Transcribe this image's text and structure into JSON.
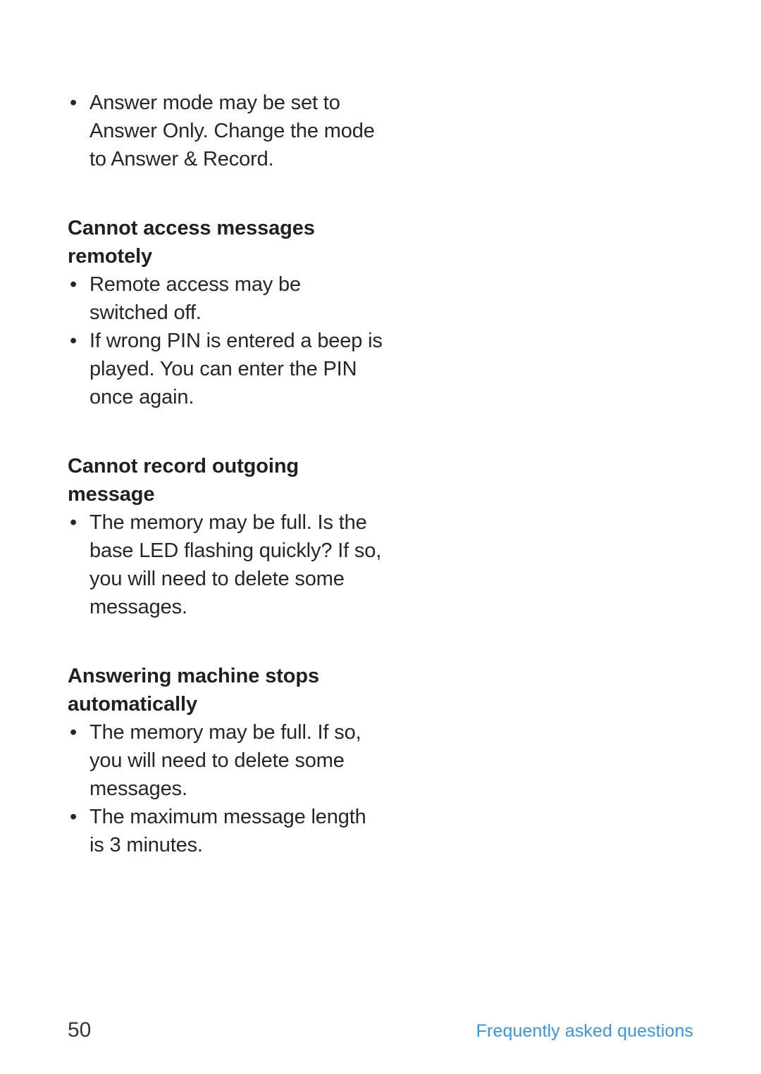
{
  "page": {
    "number": "50",
    "footer_section": "Frequently asked questions",
    "footer_link_color": "#3b96d9",
    "text_color": "#2b2426"
  },
  "blocks": [
    {
      "kind": "bullets",
      "items": [
        "Answer mode may be set to Answer Only. Change the mode to Answer & Record."
      ]
    },
    {
      "kind": "heading",
      "text": "Cannot access messages remotely"
    },
    {
      "kind": "bullets",
      "items": [
        "Remote access may be switched off.",
        "If wrong PIN is entered a beep is played. You can enter the PIN once again."
      ]
    },
    {
      "kind": "heading",
      "text": "Cannot record outgoing message"
    },
    {
      "kind": "bullets",
      "items": [
        "The memory may be full. Is the base LED flashing quickly? If so, you will need to delete some messages."
      ]
    },
    {
      "kind": "heading",
      "text": "Answering machine stops automatically"
    },
    {
      "kind": "bullets",
      "items": [
        "The memory may be full. If so, you will need to delete some messages.",
        "The maximum message length is 3 minutes."
      ]
    }
  ],
  "bullet_glyph": "•"
}
